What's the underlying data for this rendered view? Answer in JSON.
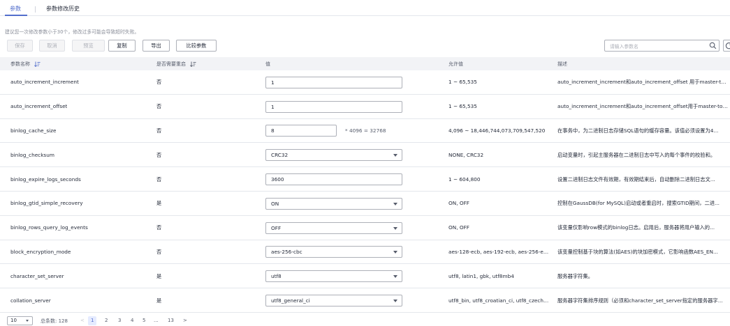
{
  "tabs": [
    "参数",
    "参数修改历史"
  ],
  "tip": "建议您一次修改参数小于30个，修改过多可能会导致超时失败。",
  "toolbar": {
    "save": "保存",
    "cancel": "取消",
    "preview": "预览",
    "copy": "复制",
    "export": "导出",
    "compare": "比较参数"
  },
  "search": {
    "placeholder": "请输入参数名"
  },
  "table": {
    "headers": {
      "name": "参数名称",
      "restart": "是否需要重启",
      "value": "值",
      "allowed": "允许值",
      "desc": "描述"
    },
    "rows": [
      {
        "name": "auto_increment_increment",
        "restart": "否",
        "kind": "input",
        "value": "1",
        "allowed": "1 ~ 65,535",
        "desc": "auto_increment_increment和auto_increment_offset 用于master-to-..."
      },
      {
        "name": "auto_increment_offset",
        "restart": "否",
        "kind": "input",
        "value": "1",
        "allowed": "1 ~ 65,535",
        "desc": "auto_increment_increment和auto_increment_offset用于master-to-..."
      },
      {
        "name": "binlog_cache_size",
        "restart": "否",
        "kind": "input-small",
        "value": "8",
        "calc": "* 4096 = 32768",
        "allowed": "4,096 ~ 18,446,744,073,709,547,520",
        "desc": "在事务中，为二进制日志存储SQL语句的缓存容量。该值必须设置为4..."
      },
      {
        "name": "binlog_checksum",
        "restart": "否",
        "kind": "select",
        "value": "CRC32",
        "allowed": "NONE, CRC32",
        "desc": "启动变量时，引起主服务器在二进制日志中写入的每个事件的校验和。"
      },
      {
        "name": "binlog_expire_logs_seconds",
        "restart": "否",
        "kind": "input",
        "value": "3600",
        "allowed": "1 ~ 604,800",
        "desc": "设置二进制日志文件有效期，有效期结束后，自动删除二进制日志文..."
      },
      {
        "name": "binlog_gtid_simple_recovery",
        "restart": "是",
        "kind": "select",
        "value": "ON",
        "allowed": "ON, OFF",
        "desc": "控制在GaussDB(for MySQL)启动或者重启时，搜索GTID期间，二进..."
      },
      {
        "name": "binlog_rows_query_log_events",
        "restart": "否",
        "kind": "select",
        "value": "OFF",
        "allowed": "ON, OFF",
        "desc": "该变量仅影响row模式的binlog日志。启用后，服务器将用户输入的..."
      },
      {
        "name": "block_encryption_mode",
        "restart": "否",
        "kind": "select",
        "value": "aes-256-cbc",
        "allowed": "aes-128-ecb, aes-192-ecb, aes-256-ec...",
        "desc": "该变量控制基于块的算法(如AES)的块加密模式，它影响函数AES_EN..."
      },
      {
        "name": "character_set_server",
        "restart": "是",
        "kind": "select",
        "value": "utf8",
        "allowed": "utf8, latin1, gbk, utf8mb4",
        "desc": "服务器字符集。"
      },
      {
        "name": "collation_server",
        "restart": "是",
        "kind": "select",
        "value": "utf8_general_ci",
        "allowed": "utf8_bin, utf8_croatian_ci, utf8_czech_...",
        "desc": "服务器字符集排序规则（必须和character_set_server指定的服务器字..."
      }
    ]
  },
  "pagination": {
    "page_size": "10",
    "total": "总条数: 128",
    "prev": "<",
    "pages": [
      "1",
      "2",
      "3",
      "4",
      "5",
      "...",
      "13"
    ],
    "next": ">"
  }
}
